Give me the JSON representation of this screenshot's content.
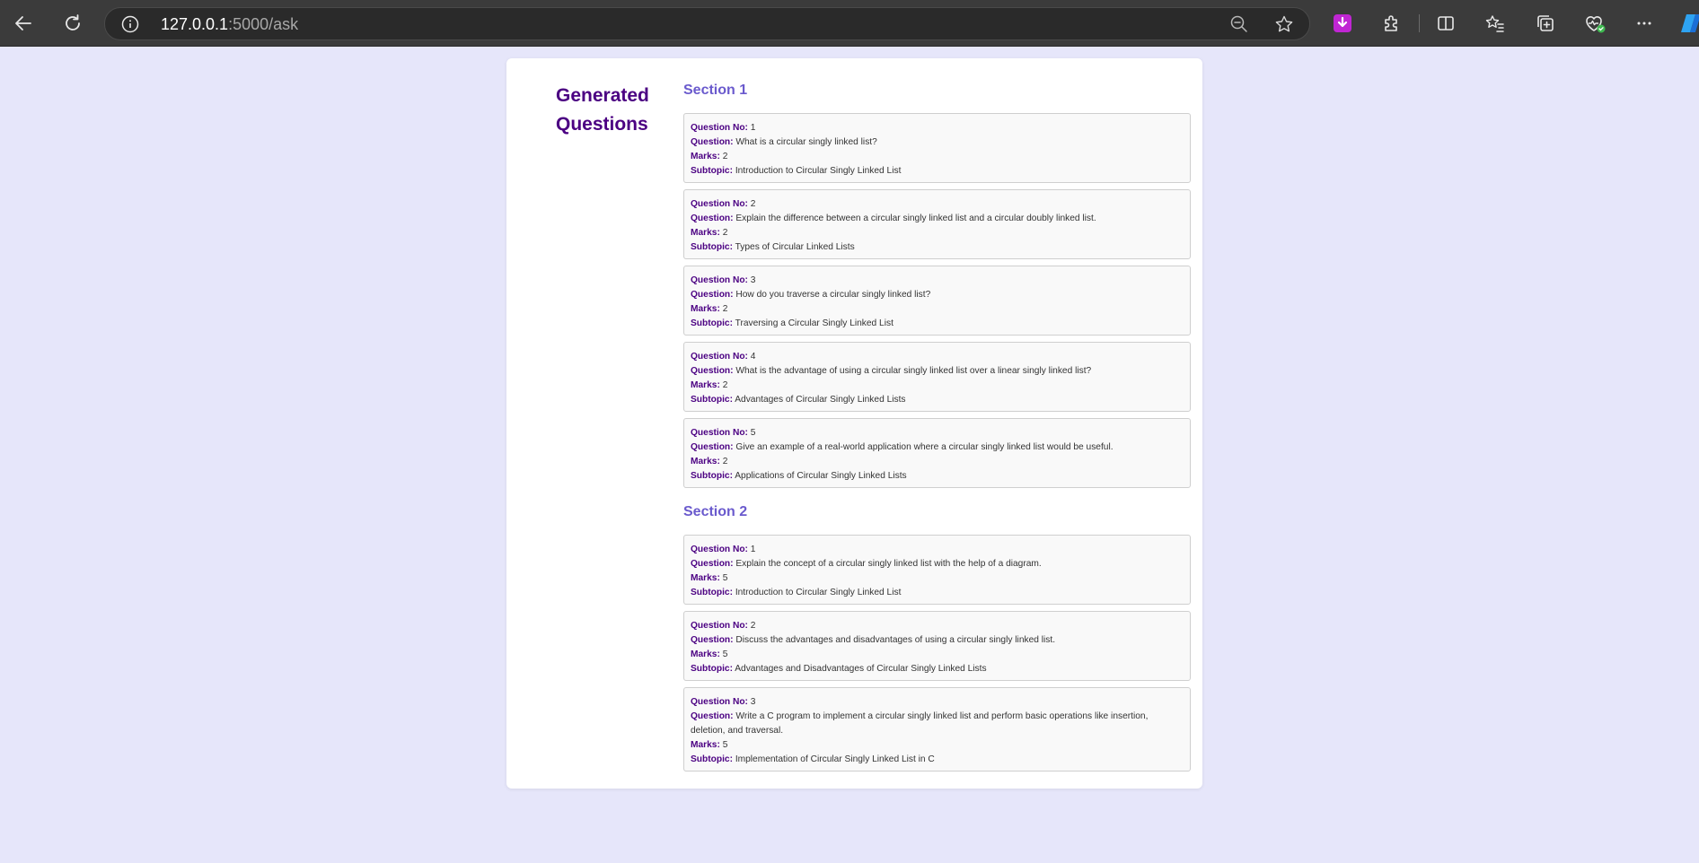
{
  "browser": {
    "url_host": "127.0.0.1",
    "url_rest": ":5000/ask"
  },
  "page": {
    "heading": "Generated Questions",
    "labels": {
      "question_no": "Question No:",
      "question": "Question:",
      "marks": "Marks:",
      "subtopic": "Subtopic:"
    },
    "sections": [
      {
        "title": "Section 1",
        "questions": [
          {
            "no": "1",
            "question": "What is a circular singly linked list?",
            "marks": "2",
            "subtopic": "Introduction to Circular Singly Linked List"
          },
          {
            "no": "2",
            "question": "Explain the difference between a circular singly linked list and a circular doubly linked list.",
            "marks": "2",
            "subtopic": "Types of Circular Linked Lists"
          },
          {
            "no": "3",
            "question": "How do you traverse a circular singly linked list?",
            "marks": "2",
            "subtopic": "Traversing a Circular Singly Linked List"
          },
          {
            "no": "4",
            "question": "What is the advantage of using a circular singly linked list over a linear singly linked list?",
            "marks": "2",
            "subtopic": "Advantages of Circular Singly Linked Lists"
          },
          {
            "no": "5",
            "question": "Give an example of a real-world application where a circular singly linked list would be useful.",
            "marks": "2",
            "subtopic": "Applications of Circular Singly Linked Lists"
          }
        ]
      },
      {
        "title": "Section 2",
        "questions": [
          {
            "no": "1",
            "question": "Explain the concept of a circular singly linked list with the help of a diagram.",
            "marks": "5",
            "subtopic": "Introduction to Circular Singly Linked List"
          },
          {
            "no": "2",
            "question": "Discuss the advantages and disadvantages of using a circular singly linked list.",
            "marks": "5",
            "subtopic": "Advantages and Disadvantages of Circular Singly Linked Lists"
          },
          {
            "no": "3",
            "question": "Write a C program to implement a circular singly linked list and perform basic operations like insertion, deletion, and traversal.",
            "marks": "5",
            "subtopic": "Implementation of Circular Singly Linked List in C"
          }
        ]
      }
    ]
  }
}
